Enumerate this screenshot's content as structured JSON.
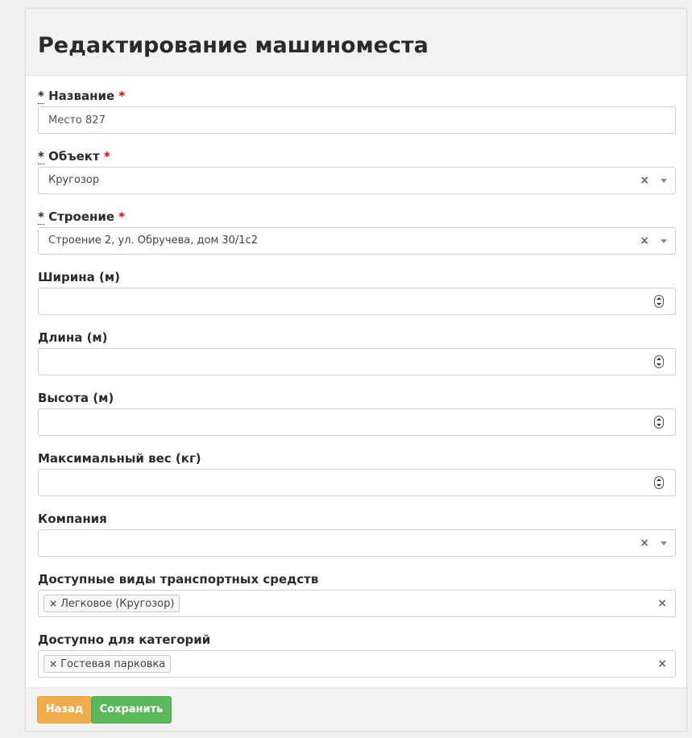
{
  "page": {
    "title": "Редактирование машиноместа"
  },
  "fields": {
    "name": {
      "label": "Название",
      "value": "Место 827"
    },
    "object": {
      "label": "Объект",
      "value": "Кругозор",
      "clear": "×"
    },
    "building": {
      "label": "Строение",
      "value": "Строение 2, ул. Обручева, дом 30/1с2",
      "clear": "×"
    },
    "width": {
      "label": "Ширина (м)",
      "value": ""
    },
    "length": {
      "label": "Длина (м)",
      "value": ""
    },
    "height": {
      "label": "Высота (м)",
      "value": ""
    },
    "max_weight": {
      "label": "Максимальный вес (кг)",
      "value": ""
    },
    "company": {
      "label": "Компания",
      "value": "",
      "clear": "×"
    },
    "vehicle_types": {
      "label": "Доступные виды транспортных средств",
      "tags": [
        "Легковое (Кругозор)"
      ],
      "clear": "×"
    },
    "categories": {
      "label": "Доступно для категорий",
      "tags": [
        "Гостевая парковка"
      ],
      "clear": "×"
    }
  },
  "markers": {
    "asterisk": "*",
    "tag_remove": "×"
  },
  "buttons": {
    "back": "Назад",
    "save": "Сохранить"
  },
  "colors": {
    "required": "#e00000",
    "back_button": "#f0ad4e",
    "save_button": "#5cb85c"
  }
}
